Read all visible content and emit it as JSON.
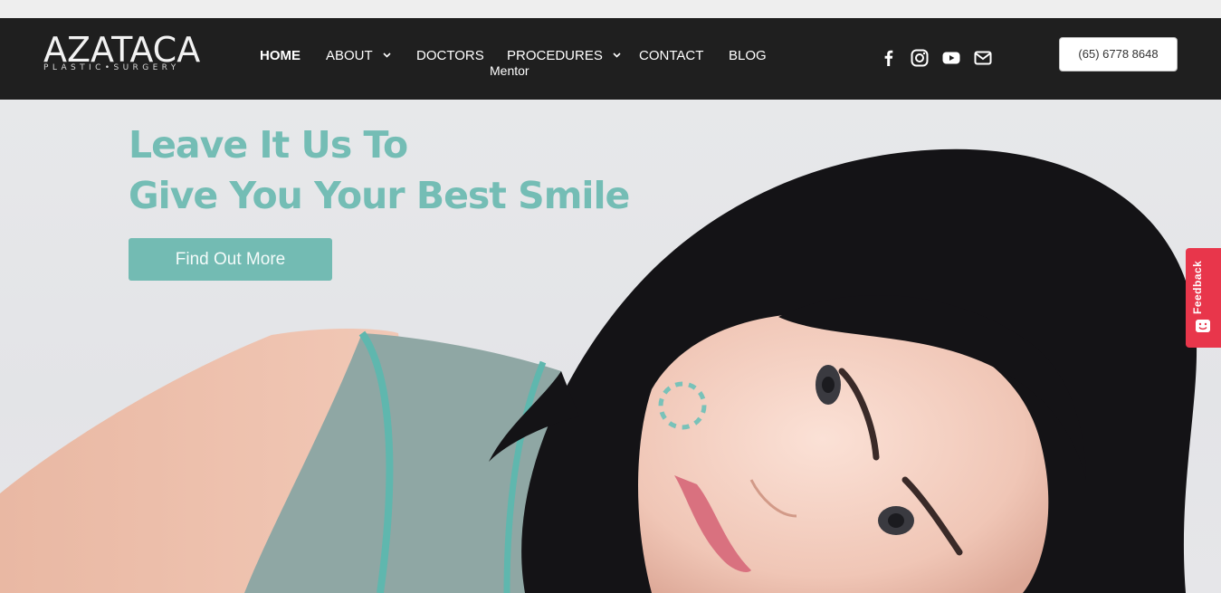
{
  "logo": {
    "main": "AZATACA",
    "sub": "PLASTIC•SURGERY"
  },
  "nav": {
    "items": [
      {
        "label": "HOME",
        "has_dropdown": false,
        "active": true
      },
      {
        "label": "ABOUT",
        "has_dropdown": true,
        "active": false
      },
      {
        "label": "DOCTORS",
        "has_dropdown": false,
        "active": false
      },
      {
        "label": "PROCEDURES",
        "has_dropdown": true,
        "active": false
      },
      {
        "label": "CONTACT",
        "has_dropdown": false,
        "active": false
      },
      {
        "label": "BLOG",
        "has_dropdown": false,
        "active": false
      }
    ],
    "mentor": "Mentor"
  },
  "social": [
    "facebook-icon",
    "instagram-icon",
    "youtube-icon",
    "mail-icon"
  ],
  "phone": "(65) 6778 8648",
  "hero": {
    "headline_line1": "Leave It Us To",
    "headline_line2": "Give You Your Best Smile",
    "cta": "Find Out More"
  },
  "feedback": {
    "label": "Feedback"
  },
  "colors": {
    "header_bg": "#1f1f1f",
    "accent": "#74bdb5",
    "feedback": "#e8364b"
  }
}
